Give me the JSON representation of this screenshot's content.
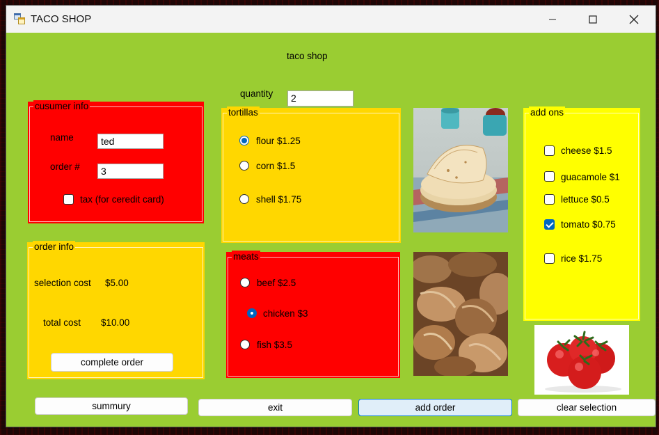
{
  "window": {
    "title": "TACO SHOP"
  },
  "header": {
    "label": "taco shop"
  },
  "quantity": {
    "label": "quantity",
    "value": "2"
  },
  "customer": {
    "title": "cusumer info",
    "name_label": "name",
    "name_value": "ted",
    "order_label": "order #",
    "order_value": "3",
    "tax_label": "tax (for ceredit card)",
    "tax_checked": false
  },
  "tortillas": {
    "title": "tortillas",
    "options": [
      {
        "label": "flour $1.25",
        "selected": true
      },
      {
        "label": "corn $1.5",
        "selected": false
      },
      {
        "label": "shell $1.75",
        "selected": false
      }
    ]
  },
  "meats": {
    "title": "meats",
    "options": [
      {
        "label": "beef $2.5",
        "selected": false
      },
      {
        "label": "chicken $3",
        "selected": true
      },
      {
        "label": "fish $3.5",
        "selected": false
      }
    ]
  },
  "addons": {
    "title": "add ons",
    "items": [
      {
        "label": "cheese $1.5",
        "checked": false
      },
      {
        "label": "guacamole $1",
        "checked": false
      },
      {
        "label": "lettuce $0.5",
        "checked": false
      },
      {
        "label": "tomato $0.75",
        "checked": true
      },
      {
        "label": "rice $1.75",
        "checked": false
      }
    ]
  },
  "order_info": {
    "title": "order info",
    "selection_label": "selection cost",
    "selection_value": "$5.00",
    "total_label": "total cost",
    "total_value": "$10.00",
    "complete_button": "complete order"
  },
  "buttons": {
    "summary": "summury",
    "exit": "exit",
    "add_order": "add order",
    "clear": "clear selection"
  },
  "colors": {
    "form_bg": "#9acd32",
    "red_group": "#ff0000",
    "gold_group": "#ffd700",
    "yellow_group": "#ffff00",
    "accent": "#0067c0"
  },
  "icons": {
    "app": "app-window-icon",
    "minimize": "minimize-icon",
    "maximize": "maximize-icon",
    "close": "close-icon"
  }
}
